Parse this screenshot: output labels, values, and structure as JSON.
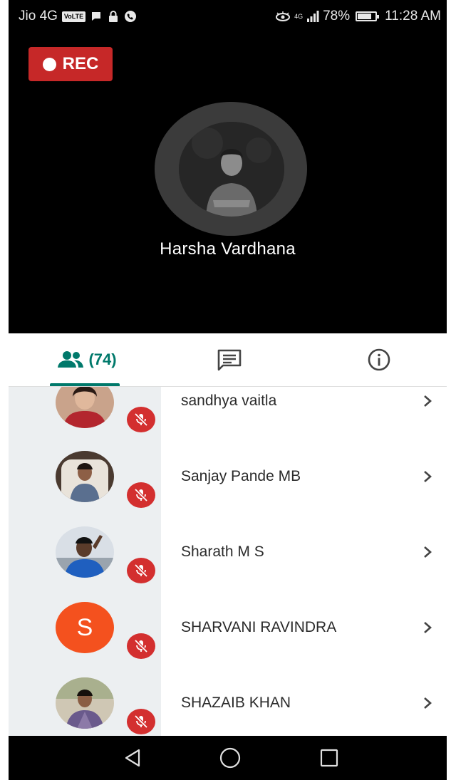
{
  "status_bar": {
    "carrier": "Jio 4G",
    "volte": "VoLTE",
    "network_small": "4G",
    "battery": "78%",
    "time": "11:28 AM"
  },
  "call": {
    "rec_label": "REC",
    "speaker_name": "Harsha Vardhana"
  },
  "tabs": {
    "people_count": "(74)",
    "accent_color": "#00796b"
  },
  "participants": [
    {
      "name": "sandhya vaitla",
      "avatar": "photo",
      "muted": true
    },
    {
      "name": "Sanjay Pande MB",
      "avatar": "photo",
      "muted": true
    },
    {
      "name": "Sharath M S",
      "avatar": "photo",
      "muted": true
    },
    {
      "name": "SHARVANI RAVINDRA",
      "avatar": "letter",
      "initial": "S",
      "muted": true
    },
    {
      "name": "SHAZAIB KHAN",
      "avatar": "photo",
      "muted": true
    }
  ],
  "icons": {
    "people": "people-icon",
    "chat": "chat-icon",
    "info": "info-icon",
    "mic_off": "mic-off-icon",
    "chevron": "chevron-right-icon",
    "back": "back-triangle-icon",
    "home": "home-circle-icon",
    "recents": "recents-square-icon"
  },
  "colors": {
    "rec": "#c62828",
    "mute": "#d32f2f",
    "letter_avatar": "#f4511e"
  }
}
